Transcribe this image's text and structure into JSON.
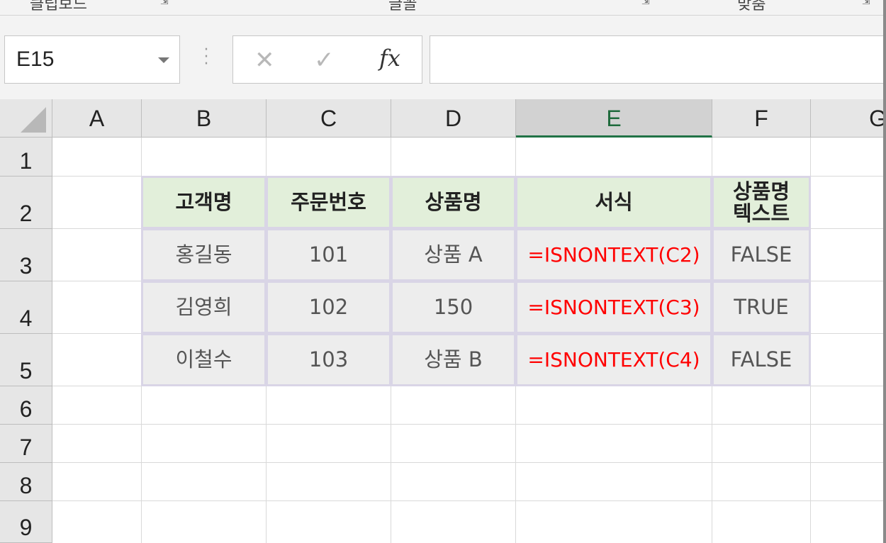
{
  "ribbon": {
    "groups": [
      "클립보드",
      "글꼴",
      "맞춤"
    ]
  },
  "formula_bar": {
    "name_box": "E15",
    "cancel_icon": "✕",
    "enter_icon": "✓",
    "fx_label": "fx",
    "formula": ""
  },
  "columns": [
    "A",
    "B",
    "C",
    "D",
    "E",
    "F",
    "G"
  ],
  "active_column": "E",
  "rows": [
    "1",
    "2",
    "3",
    "4",
    "5",
    "6",
    "7",
    "8",
    "9"
  ],
  "table": {
    "headers": [
      "고객명",
      "주문번호",
      "상품명",
      "서식",
      "상품명\n텍스트"
    ],
    "rows": [
      [
        "홍길동",
        "101",
        "상품 A",
        "=ISNONTEXT(C2)",
        "FALSE"
      ],
      [
        "김영희",
        "102",
        "150",
        "=ISNONTEXT(C3)",
        "TRUE"
      ],
      [
        "이철수",
        "103",
        "상품 B",
        "=ISNONTEXT(C4)",
        "FALSE"
      ]
    ]
  },
  "colors": {
    "header_fill": "#e2efda",
    "body_fill": "#ededed",
    "formula_text": "#ff0000",
    "active_header_accent": "#217346"
  }
}
